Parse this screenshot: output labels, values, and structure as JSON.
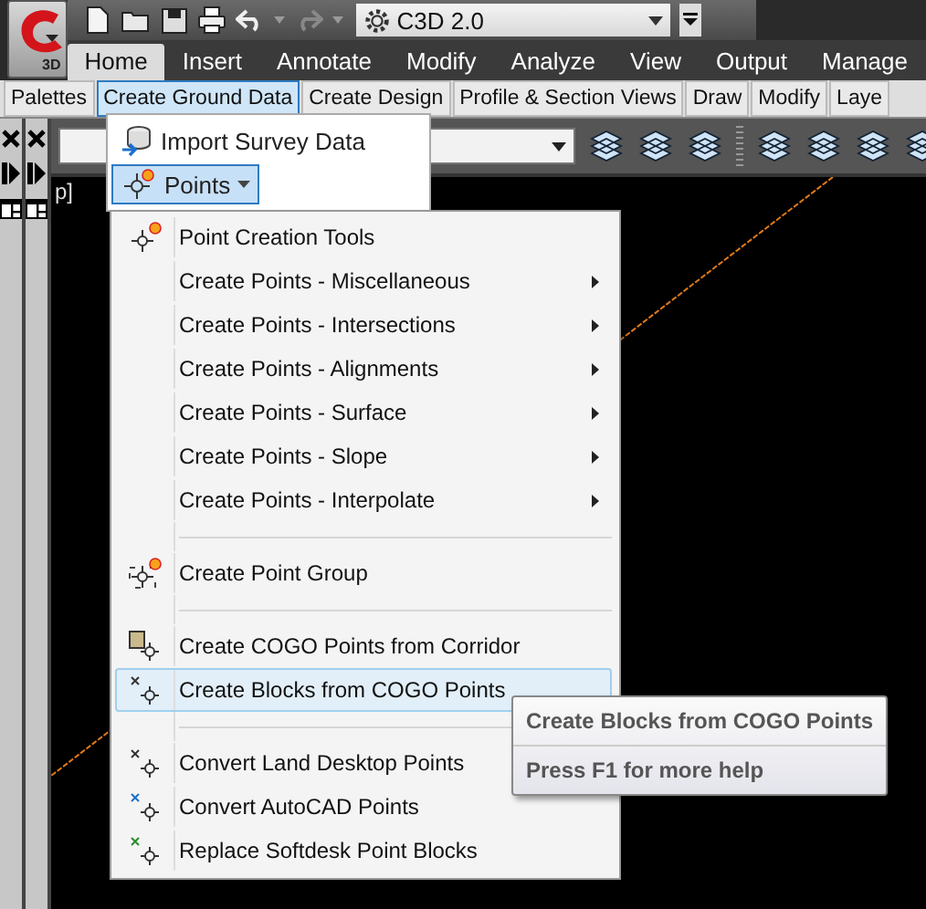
{
  "app_button": {
    "badge": "3D"
  },
  "workspace": {
    "value": "C3D 2.0"
  },
  "ribbon_tabs": [
    {
      "label": "Home",
      "selected": true
    },
    {
      "label": "Insert",
      "selected": false
    },
    {
      "label": "Annotate",
      "selected": false
    },
    {
      "label": "Modify",
      "selected": false
    },
    {
      "label": "Analyze",
      "selected": false
    },
    {
      "label": "View",
      "selected": false
    },
    {
      "label": "Output",
      "selected": false
    },
    {
      "label": "Manage",
      "selected": false
    }
  ],
  "panels": [
    {
      "label": "Palettes",
      "selected": false
    },
    {
      "label": "Create Ground Data",
      "selected": true
    },
    {
      "label": "Create Design",
      "selected": false
    },
    {
      "label": "Profile & Section Views",
      "selected": false
    },
    {
      "label": "Draw",
      "selected": false
    },
    {
      "label": "Modify",
      "selected": false
    },
    {
      "label": "Laye",
      "selected": false
    }
  ],
  "viewport_label": "p]",
  "ground_menu": {
    "items": [
      {
        "label": "Import Survey Data",
        "kind": "item",
        "selected": false
      },
      {
        "label": "Points",
        "kind": "dropdown",
        "selected": true
      }
    ]
  },
  "points_menu": {
    "items": [
      {
        "kind": "item",
        "label": "Point Creation Tools",
        "submenu": false,
        "selected": false
      },
      {
        "kind": "item",
        "label": "Create Points - Miscellaneous",
        "submenu": true,
        "selected": false
      },
      {
        "kind": "item",
        "label": "Create Points - Intersections",
        "submenu": true,
        "selected": false
      },
      {
        "kind": "item",
        "label": "Create Points - Alignments",
        "submenu": true,
        "selected": false
      },
      {
        "kind": "item",
        "label": "Create Points - Surface",
        "submenu": true,
        "selected": false
      },
      {
        "kind": "item",
        "label": "Create Points - Slope",
        "submenu": true,
        "selected": false
      },
      {
        "kind": "item",
        "label": "Create Points - Interpolate",
        "submenu": true,
        "selected": false
      },
      {
        "kind": "separator"
      },
      {
        "kind": "item",
        "label": "Create Point Group",
        "submenu": false,
        "selected": false
      },
      {
        "kind": "separator"
      },
      {
        "kind": "item",
        "label": "Create COGO Points from Corridor",
        "submenu": false,
        "selected": false
      },
      {
        "kind": "item",
        "label": "Create Blocks from COGO Points",
        "submenu": false,
        "selected": true
      },
      {
        "kind": "separator"
      },
      {
        "kind": "item",
        "label": "Convert Land Desktop Points",
        "submenu": false,
        "selected": false
      },
      {
        "kind": "item",
        "label": "Convert AutoCAD Points",
        "submenu": false,
        "selected": false
      },
      {
        "kind": "item",
        "label": "Replace Softdesk Point Blocks",
        "submenu": false,
        "selected": false
      }
    ]
  },
  "tooltip": {
    "title": "Create Blocks from COGO Points",
    "help": "Press F1 for more help"
  }
}
